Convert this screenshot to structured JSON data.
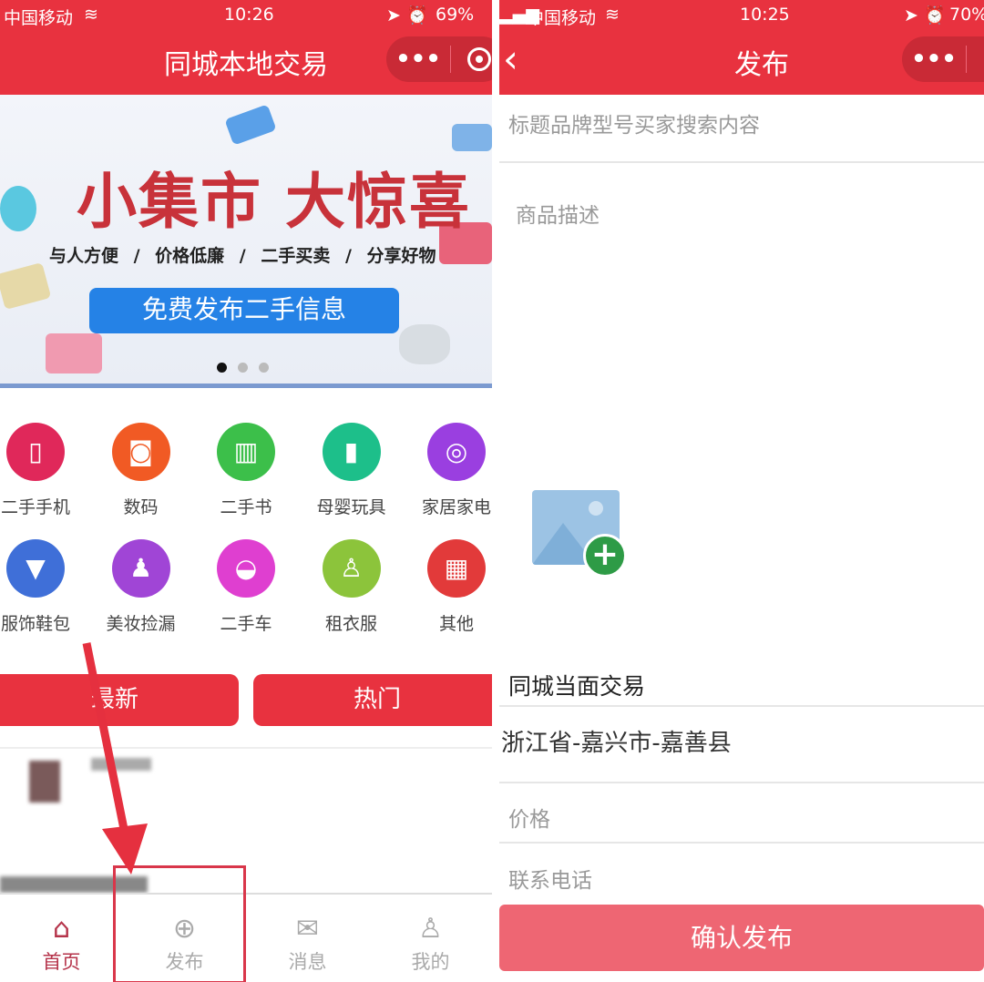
{
  "left": {
    "status": {
      "carrier": "中国移动",
      "time": "10:26",
      "battery": "69%"
    },
    "nav": {
      "title": "同城本地交易",
      "more_icon": "•••"
    },
    "banner": {
      "title": "小集市 大惊喜",
      "subtitle": "与人方便 / 价格低廉 / 二手买卖 / 分享好物",
      "cta": "免费发布二手信息",
      "slides": 3,
      "active_slide": 1
    },
    "categories": [
      {
        "label": "二手手机",
        "icon": "phone-icon",
        "color": "#e0285a",
        "glyph": "▯"
      },
      {
        "label": "数码",
        "icon": "camera-icon",
        "color": "#f15a24",
        "glyph": "◙"
      },
      {
        "label": "二手书",
        "icon": "books-icon",
        "color": "#3cbf4a",
        "glyph": "▥"
      },
      {
        "label": "母婴玩具",
        "icon": "bottle-icon",
        "color": "#1dbf8a",
        "glyph": "▮"
      },
      {
        "label": "家居家电",
        "icon": "washer-icon",
        "color": "#9a3fe0",
        "glyph": "◎"
      },
      {
        "label": "服饰鞋包",
        "icon": "shirt-icon",
        "color": "#3f6fd8",
        "glyph": "▼"
      },
      {
        "label": "美妆捡漏",
        "icon": "cosmetics-icon",
        "color": "#a045d6",
        "glyph": "♟"
      },
      {
        "label": "二手车",
        "icon": "car-icon",
        "color": "#df3fd0",
        "glyph": "◒"
      },
      {
        "label": "租衣服",
        "icon": "dress-icon",
        "color": "#8cc43b",
        "glyph": "♙"
      },
      {
        "label": "其他",
        "icon": "grid-icon",
        "color": "#e23a3a",
        "glyph": "▦"
      }
    ],
    "tabs": [
      "最新",
      "热门"
    ],
    "tabbar": [
      {
        "label": "首页",
        "icon": "home-icon",
        "glyph": "⌂",
        "active": true
      },
      {
        "label": "发布",
        "icon": "plus-circle-icon",
        "glyph": "⊕",
        "active": false
      },
      {
        "label": "消息",
        "icon": "mail-icon",
        "glyph": "✉",
        "active": false
      },
      {
        "label": "我的",
        "icon": "user-icon",
        "glyph": "♙",
        "active": false
      }
    ]
  },
  "right": {
    "status": {
      "carrier": "中国移动",
      "time": "10:25",
      "battery": "70%"
    },
    "nav": {
      "back": "‹",
      "title": "发布",
      "more_icon": "•••"
    },
    "form": {
      "title_placeholder": "标题品牌型号买家搜索内容",
      "desc_placeholder": "商品描述",
      "section": "同城当面交易",
      "location": "浙江省-嘉兴市-嘉善县",
      "price_placeholder": "价格",
      "phone_placeholder": "联系电话",
      "submit": "确认发布"
    }
  },
  "colors": {
    "brand": "#e8323f",
    "submit": "#ee6673",
    "active_tab": "#b5334a",
    "annotation": "#e5303f"
  }
}
